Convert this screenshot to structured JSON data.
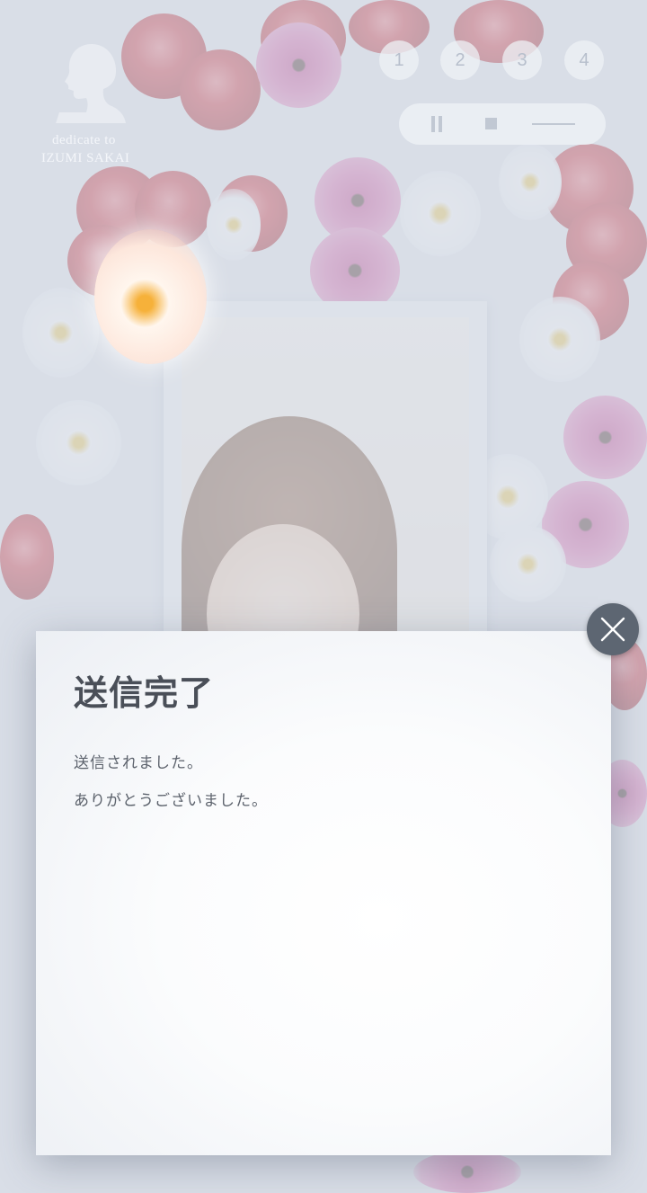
{
  "background": {
    "dedicate_line1": "dedicate to",
    "dedicate_line2": "IZUMI SAKAI"
  },
  "pager": {
    "pages": [
      "1",
      "2",
      "3",
      "4"
    ]
  },
  "player": {
    "controls": [
      "pause-icon",
      "stop-icon",
      "volume-slider"
    ]
  },
  "modal": {
    "title": "送信完了",
    "message_line1": "送信されました。",
    "message_line2": "ありがとうございました。",
    "close_icon": "close-icon"
  },
  "colors": {
    "modal_title": "#4a4f58",
    "modal_text": "#5c626c",
    "close_button": "#5d6672",
    "background_tint": "#dfe4ec"
  }
}
